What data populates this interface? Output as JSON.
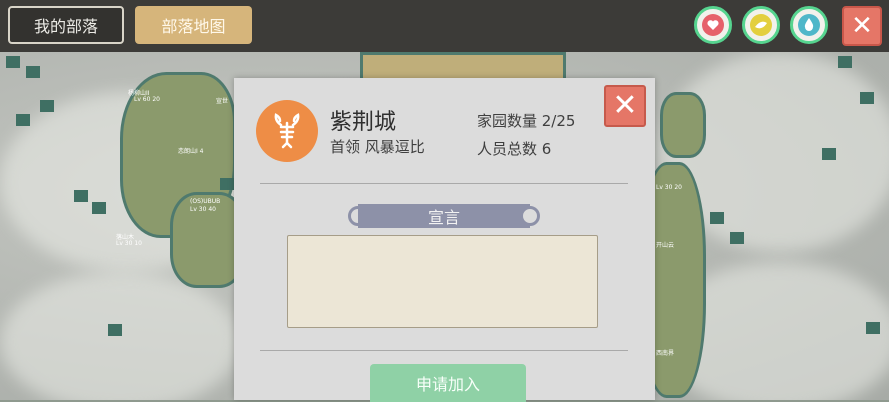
{
  "topbar": {
    "tab_my_tribe": "我的部落",
    "tab_tribe_map": "部落地图",
    "icons": [
      "heart-icon",
      "food-icon",
      "water-drop-icon",
      "close-icon"
    ],
    "close_glyph": "✕"
  },
  "map": {
    "labels": [
      "杨柳山II",
      "Lv 60 20",
      "宣世",
      "恋朗山I 4",
      "(OS)UBUB",
      "Lv 30 40",
      "落山木",
      "Lv 30 10",
      "Lv 30 20",
      "开山云",
      "西南界"
    ]
  },
  "dialog": {
    "tribe_name": "紫荆城",
    "leader_line": "首领 风暴逗比",
    "homes_line": "家园数量 2/25",
    "members_line": "人员总数 6",
    "declaration_title": "宣言",
    "declaration_text": "",
    "apply_button": "申请加入",
    "close_glyph": "✕"
  },
  "colors": {
    "accent_gold": "#d6b57b",
    "close_red": "#e57667",
    "status_green": "#56d48f",
    "emblem_orange": "#ee8d46",
    "apply_green": "#8fd1a6"
  }
}
